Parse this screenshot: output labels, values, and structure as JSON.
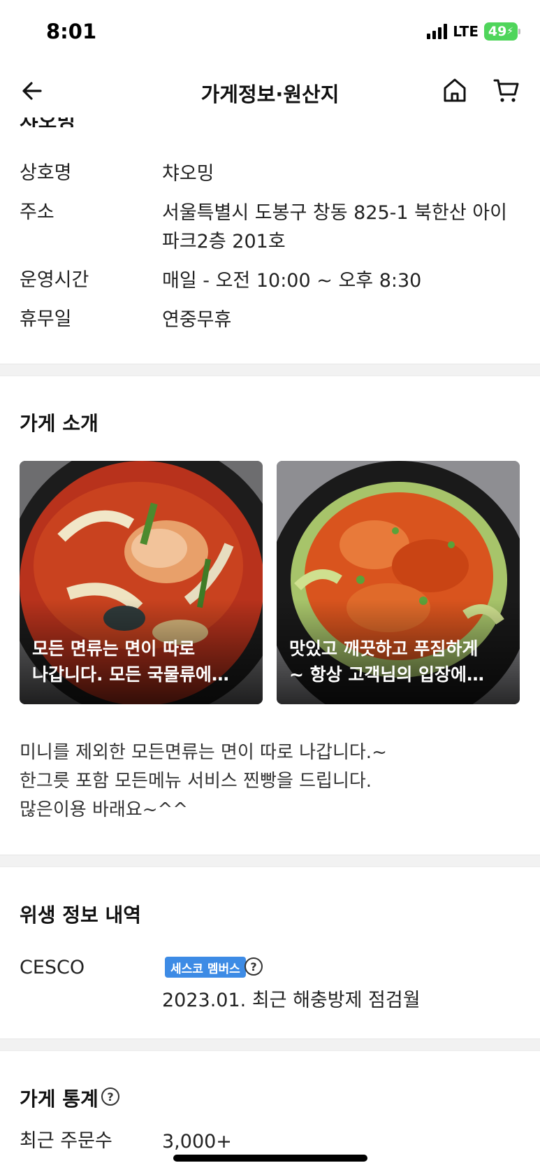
{
  "status_bar": {
    "time": "8:01",
    "network": "LTE",
    "battery": "49"
  },
  "nav": {
    "title": "가게정보·원산지"
  },
  "cut_heading": "챠오밍",
  "store_info": [
    {
      "label": "상호명",
      "value_lines": [
        "챠오밍"
      ]
    },
    {
      "label": "주소",
      "value_lines": [
        "서울특별시 도봉구 창동 825-1 북한산 아이",
        "파크2층 201호"
      ]
    },
    {
      "label": "운영시간",
      "value_lines": [
        "매일 - 오전 10:00 ~ 오후 8:30"
      ]
    },
    {
      "label": "휴무일",
      "value_lines": [
        "연중무휴"
      ]
    }
  ],
  "intro": {
    "title": "가게 소개",
    "photos": [
      {
        "caption_lines": [
          "모든 면류는 면이 따로",
          "나갑니다. 모든 국물류에…"
        ]
      },
      {
        "caption_lines": [
          "맛있고 깨끗하고 푸짐하게",
          "~ 항상 고객님의 입장에…"
        ]
      }
    ],
    "text_lines": [
      "미니를 제외한 모든면류는 면이 따로 나갑니다.~",
      "한그릇 포함 모든메뉴 서비스 찐빵을 드립니다.",
      "많은이용 바래요~^^"
    ]
  },
  "hygiene": {
    "title": "위생 정보 내역",
    "label": "CESCO",
    "badge": "세스코 멤버스",
    "help": "?",
    "detail": "2023.01. 최근 해충방제 점검월"
  },
  "stats": {
    "title": "가게 통계",
    "help": "?",
    "rows": [
      {
        "label": "최근 주문수",
        "value": "3,000+"
      }
    ]
  },
  "colors": {
    "badge": "#3d8be5",
    "battery": "#4fd55b",
    "divider": "#f2f2f2"
  }
}
